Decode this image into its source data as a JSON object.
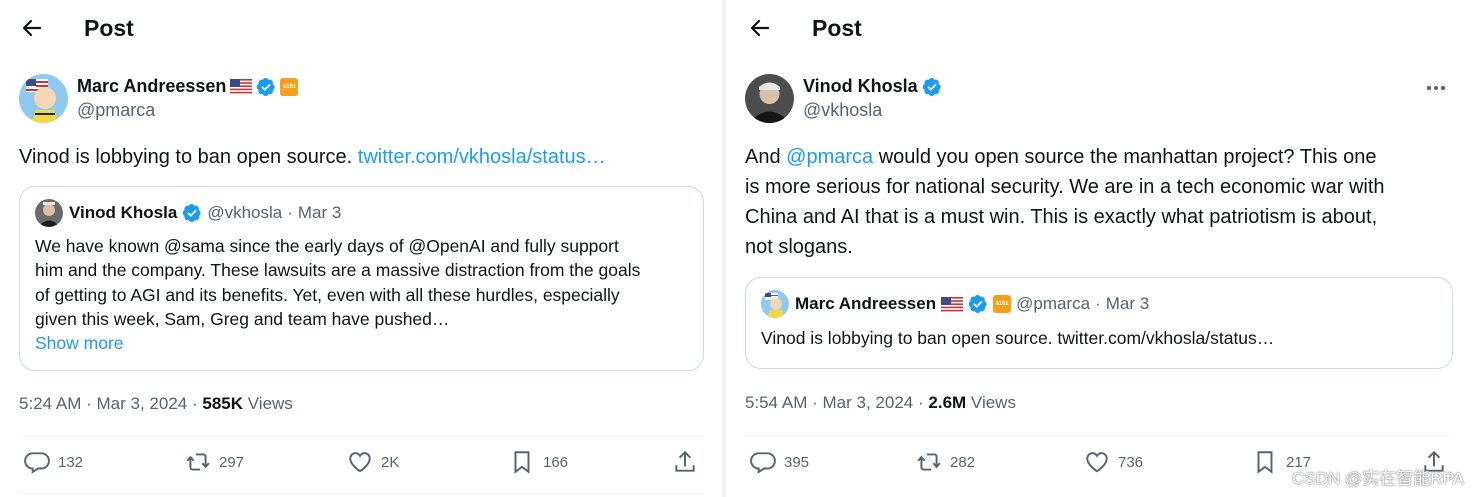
{
  "left": {
    "header_title": "Post",
    "author": {
      "name": "Marc Andreessen",
      "handle": "@pmarca",
      "flag": "us-flag-icon",
      "affiliate_badge": "a16z"
    },
    "text": "Vinod is lobbying to ban open source. ",
    "link": "twitter.com/vkhosla/status…",
    "quote": {
      "name": "Vinod Khosla",
      "handle": "@vkhosla",
      "dot": "·",
      "date": "Mar 3",
      "lines": [
        "We have known @sama  since the early days of @OpenAI  and fully support",
        "him and the company. These lawsuits are a massive distraction from the goals",
        "of getting to AGI and its benefits. Yet, even with all these hurdles, especially",
        "given this week, Sam, Greg and team have pushed…"
      ],
      "show_more": "Show more"
    },
    "meta": {
      "time": "5:24 AM",
      "sep": "·",
      "date": "Mar 3, 2024",
      "sep2": "·",
      "views_count": "585K",
      "views_label": " Views"
    },
    "actions": {
      "replies": "132",
      "reposts": "297",
      "likes": "2K",
      "bookmarks": "166"
    }
  },
  "right": {
    "header_title": "Post",
    "author": {
      "name": "Vinod Khosla",
      "handle": "@vkhosla"
    },
    "text_lines": [
      {
        "pre": "And ",
        "mention": "@pmarca",
        "post": " would you open source the manhattan project? This one"
      },
      {
        "pre": "is more serious for national security. We are in a tech economic war with"
      },
      {
        "pre": "China and AI that is a must win. This is exactly what patriotism is about,"
      },
      {
        "pre": "not slogans."
      }
    ],
    "quote": {
      "name": "Marc Andreessen",
      "handle": "@pmarca",
      "dot": "·",
      "date": "Mar 3",
      "affiliate_badge": "a16z",
      "body": "Vinod is lobbying to ban open source. twitter.com/vkhosla/status…"
    },
    "meta": {
      "time": "5:54 AM",
      "sep": "·",
      "date": "Mar 3, 2024",
      "sep2": "·",
      "views_count": "2.6M",
      "views_label": " Views"
    },
    "actions": {
      "replies": "395",
      "reposts": "282",
      "likes": "736",
      "bookmarks": "217"
    }
  },
  "watermark": "CSDN @实在智能RPA",
  "colors": {
    "accent": "#1d9bf0",
    "secondary_text": "#536471",
    "border": "#cfd9de"
  }
}
